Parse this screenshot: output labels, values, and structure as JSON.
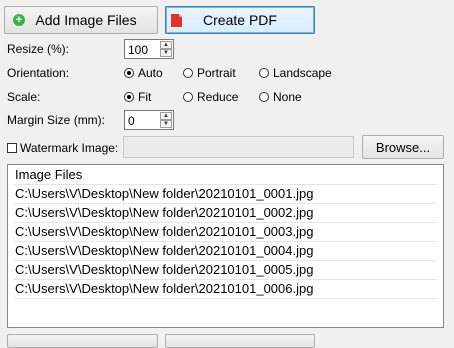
{
  "toolbar": {
    "add_label": "Add Image Files",
    "create_label": "Create PDF"
  },
  "form": {
    "resize_label": "Resize (%):",
    "resize_value": "100",
    "orientation_label": "Orientation:",
    "orientation_options": [
      "Auto",
      "Portrait",
      "Landscape"
    ],
    "orientation_selected": "Auto",
    "scale_label": "Scale:",
    "scale_options": [
      "Fit",
      "Reduce",
      "None"
    ],
    "scale_selected": "Fit",
    "margin_label": "Margin Size (mm):",
    "margin_value": "0",
    "watermark_label": "Watermark Image:",
    "watermark_value": "",
    "browse_label": "Browse..."
  },
  "list": {
    "header": "Image Files",
    "items": [
      "C:\\Users\\V\\Desktop\\New folder\\20210101_0001.jpg",
      "C:\\Users\\V\\Desktop\\New folder\\20210101_0002.jpg",
      "C:\\Users\\V\\Desktop\\New folder\\20210101_0003.jpg",
      "C:\\Users\\V\\Desktop\\New folder\\20210101_0004.jpg",
      "C:\\Users\\V\\Desktop\\New folder\\20210101_0005.jpg",
      "C:\\Users\\V\\Desktop\\New folder\\20210101_0006.jpg"
    ]
  },
  "colors": {
    "add_icon": "#3bb34a",
    "pdf_icon": "#e0332b"
  }
}
